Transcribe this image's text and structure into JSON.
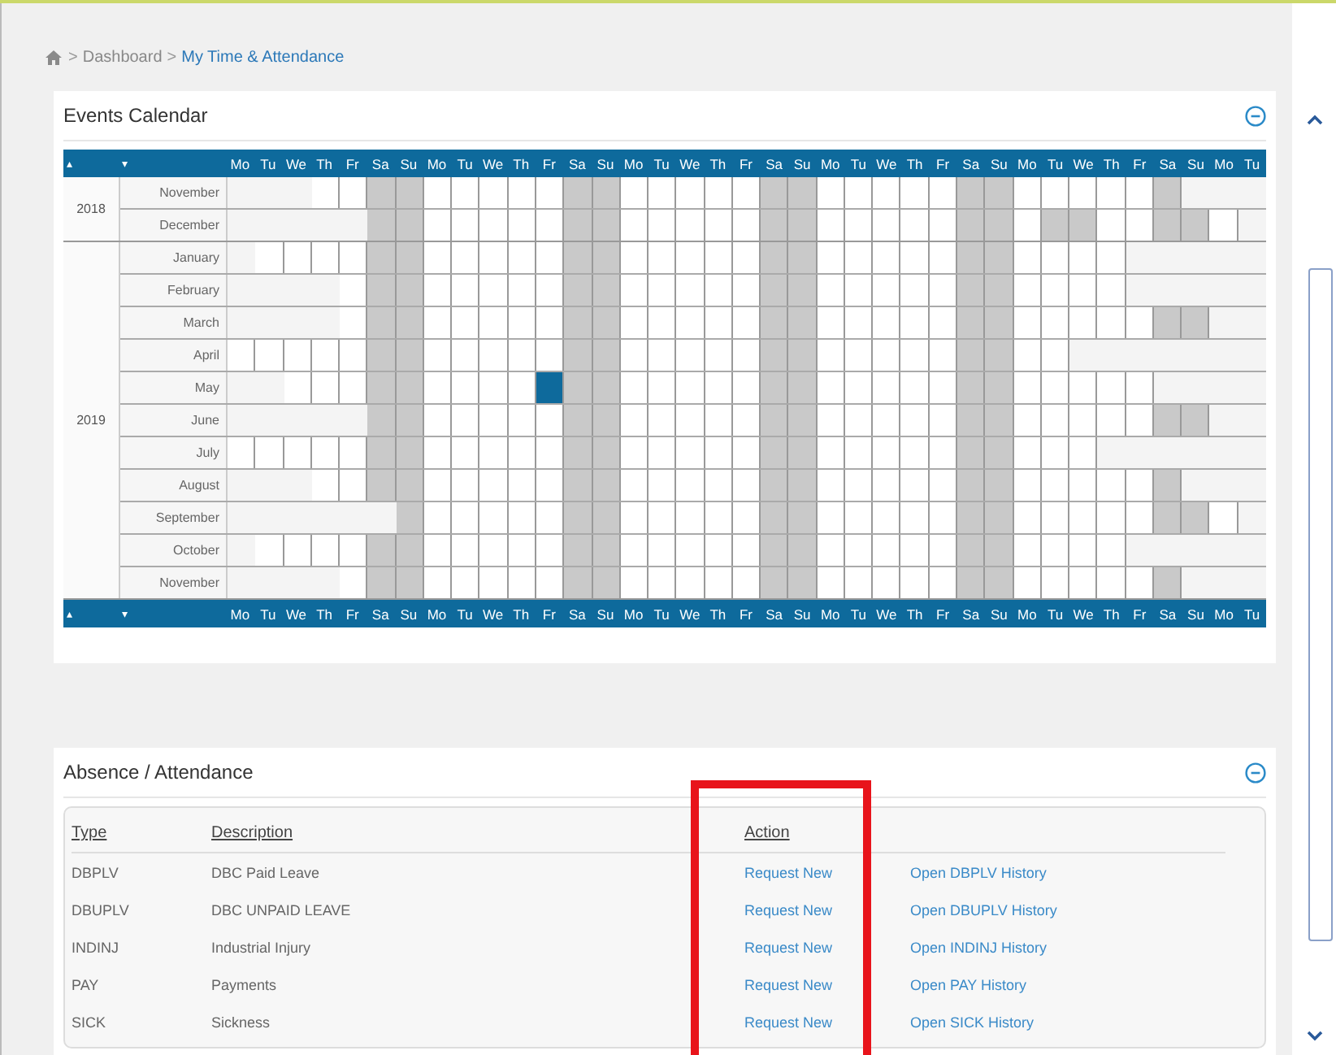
{
  "breadcrumb": {
    "separator": ">",
    "items": [
      {
        "label": "Dashboard",
        "current": false
      },
      {
        "label": "My Time & Attendance",
        "current": true
      }
    ]
  },
  "calendar": {
    "title": "Events Calendar",
    "header": {
      "prev": "▴",
      "next": "▾",
      "days": [
        "Mo",
        "Tu",
        "We",
        "Th",
        "Fr",
        "Sa",
        "Su",
        "Mo",
        "Tu",
        "We",
        "Th",
        "Fr",
        "Sa",
        "Su",
        "Mo",
        "Tu",
        "We",
        "Th",
        "Fr",
        "Sa",
        "Su",
        "Mo",
        "Tu",
        "We",
        "Th",
        "Fr",
        "Sa",
        "Su",
        "Mo",
        "Tu",
        "We",
        "Th",
        "Fr",
        "Sa",
        "Su",
        "Mo",
        "Tu"
      ]
    },
    "years": [
      {
        "year": "2018",
        "months": [
          {
            "name": "November",
            "cells": [
              {
                "kind": "out"
              },
              {
                "kind": "out"
              },
              {
                "kind": "out"
              },
              {
                "kind": "day"
              },
              {
                "kind": "day"
              },
              {
                "kind": "off"
              },
              {
                "kind": "off"
              },
              {
                "kind": "day"
              },
              {
                "kind": "day"
              },
              {
                "kind": "day"
              },
              {
                "kind": "day"
              },
              {
                "kind": "day"
              },
              {
                "kind": "off"
              },
              {
                "kind": "off"
              },
              {
                "kind": "day"
              },
              {
                "kind": "day"
              },
              {
                "kind": "day"
              },
              {
                "kind": "day"
              },
              {
                "kind": "day"
              },
              {
                "kind": "off"
              },
              {
                "kind": "off"
              },
              {
                "kind": "day"
              },
              {
                "kind": "day"
              },
              {
                "kind": "day"
              },
              {
                "kind": "day"
              },
              {
                "kind": "day"
              },
              {
                "kind": "off"
              },
              {
                "kind": "off"
              },
              {
                "kind": "day"
              },
              {
                "kind": "day"
              },
              {
                "kind": "day"
              },
              {
                "kind": "day"
              },
              {
                "kind": "day"
              },
              {
                "kind": "off"
              },
              {
                "kind": "out"
              },
              {
                "kind": "out"
              },
              {
                "kind": "out"
              }
            ]
          },
          {
            "name": "December",
            "cells": [
              {
                "kind": "out"
              },
              {
                "kind": "out"
              },
              {
                "kind": "out"
              },
              {
                "kind": "out"
              },
              {
                "kind": "out"
              },
              {
                "kind": "off"
              },
              {
                "kind": "off"
              },
              {
                "kind": "day"
              },
              {
                "kind": "day"
              },
              {
                "kind": "day"
              },
              {
                "kind": "day"
              },
              {
                "kind": "day"
              },
              {
                "kind": "off"
              },
              {
                "kind": "off"
              },
              {
                "kind": "day"
              },
              {
                "kind": "day"
              },
              {
                "kind": "day"
              },
              {
                "kind": "day"
              },
              {
                "kind": "day"
              },
              {
                "kind": "off"
              },
              {
                "kind": "off"
              },
              {
                "kind": "day"
              },
              {
                "kind": "day"
              },
              {
                "kind": "day"
              },
              {
                "kind": "day"
              },
              {
                "kind": "day"
              },
              {
                "kind": "off"
              },
              {
                "kind": "off"
              },
              {
                "kind": "day"
              },
              {
                "kind": "off"
              },
              {
                "kind": "off"
              },
              {
                "kind": "day"
              },
              {
                "kind": "day"
              },
              {
                "kind": "off"
              },
              {
                "kind": "off"
              },
              {
                "kind": "day"
              },
              {
                "kind": "out"
              }
            ]
          }
        ]
      },
      {
        "year": "2019",
        "months": [
          {
            "name": "January",
            "cells": [
              {
                "kind": "out"
              },
              {
                "kind": "day"
              },
              {
                "kind": "day"
              },
              {
                "kind": "day"
              },
              {
                "kind": "day"
              },
              {
                "kind": "off"
              },
              {
                "kind": "off"
              },
              {
                "kind": "day"
              },
              {
                "kind": "day"
              },
              {
                "kind": "day"
              },
              {
                "kind": "day"
              },
              {
                "kind": "day"
              },
              {
                "kind": "off"
              },
              {
                "kind": "off"
              },
              {
                "kind": "day"
              },
              {
                "kind": "day"
              },
              {
                "kind": "day"
              },
              {
                "kind": "day"
              },
              {
                "kind": "day"
              },
              {
                "kind": "off"
              },
              {
                "kind": "off"
              },
              {
                "kind": "day"
              },
              {
                "kind": "day"
              },
              {
                "kind": "day"
              },
              {
                "kind": "day"
              },
              {
                "kind": "day"
              },
              {
                "kind": "off"
              },
              {
                "kind": "off"
              },
              {
                "kind": "day"
              },
              {
                "kind": "day"
              },
              {
                "kind": "day"
              },
              {
                "kind": "day"
              },
              {
                "kind": "out"
              },
              {
                "kind": "out"
              },
              {
                "kind": "out"
              },
              {
                "kind": "out"
              },
              {
                "kind": "out"
              }
            ]
          },
          {
            "name": "February",
            "cells": [
              {
                "kind": "out"
              },
              {
                "kind": "out"
              },
              {
                "kind": "out"
              },
              {
                "kind": "out"
              },
              {
                "kind": "day"
              },
              {
                "kind": "off"
              },
              {
                "kind": "off"
              },
              {
                "kind": "day"
              },
              {
                "kind": "day"
              },
              {
                "kind": "day"
              },
              {
                "kind": "day"
              },
              {
                "kind": "day"
              },
              {
                "kind": "off"
              },
              {
                "kind": "off"
              },
              {
                "kind": "day"
              },
              {
                "kind": "day"
              },
              {
                "kind": "day"
              },
              {
                "kind": "day"
              },
              {
                "kind": "day"
              },
              {
                "kind": "off"
              },
              {
                "kind": "off"
              },
              {
                "kind": "day"
              },
              {
                "kind": "day"
              },
              {
                "kind": "day"
              },
              {
                "kind": "day"
              },
              {
                "kind": "day"
              },
              {
                "kind": "off"
              },
              {
                "kind": "off"
              },
              {
                "kind": "day"
              },
              {
                "kind": "day"
              },
              {
                "kind": "day"
              },
              {
                "kind": "day"
              },
              {
                "kind": "out"
              },
              {
                "kind": "out"
              },
              {
                "kind": "out"
              },
              {
                "kind": "out"
              },
              {
                "kind": "out"
              }
            ]
          },
          {
            "name": "March",
            "cells": [
              {
                "kind": "out"
              },
              {
                "kind": "out"
              },
              {
                "kind": "out"
              },
              {
                "kind": "out"
              },
              {
                "kind": "day"
              },
              {
                "kind": "off"
              },
              {
                "kind": "off"
              },
              {
                "kind": "day"
              },
              {
                "kind": "day"
              },
              {
                "kind": "day"
              },
              {
                "kind": "day"
              },
              {
                "kind": "day"
              },
              {
                "kind": "off"
              },
              {
                "kind": "off"
              },
              {
                "kind": "day"
              },
              {
                "kind": "day"
              },
              {
                "kind": "day"
              },
              {
                "kind": "day"
              },
              {
                "kind": "day"
              },
              {
                "kind": "off"
              },
              {
                "kind": "off"
              },
              {
                "kind": "day"
              },
              {
                "kind": "day"
              },
              {
                "kind": "day"
              },
              {
                "kind": "day"
              },
              {
                "kind": "day"
              },
              {
                "kind": "off"
              },
              {
                "kind": "off"
              },
              {
                "kind": "day"
              },
              {
                "kind": "day"
              },
              {
                "kind": "day"
              },
              {
                "kind": "day"
              },
              {
                "kind": "day"
              },
              {
                "kind": "off"
              },
              {
                "kind": "off"
              },
              {
                "kind": "out"
              },
              {
                "kind": "out"
              }
            ]
          },
          {
            "name": "April",
            "cells": [
              {
                "kind": "day"
              },
              {
                "kind": "day"
              },
              {
                "kind": "day"
              },
              {
                "kind": "day"
              },
              {
                "kind": "day"
              },
              {
                "kind": "off"
              },
              {
                "kind": "off"
              },
              {
                "kind": "day"
              },
              {
                "kind": "day"
              },
              {
                "kind": "day"
              },
              {
                "kind": "day"
              },
              {
                "kind": "day"
              },
              {
                "kind": "off"
              },
              {
                "kind": "off"
              },
              {
                "kind": "day"
              },
              {
                "kind": "day"
              },
              {
                "kind": "day"
              },
              {
                "kind": "day"
              },
              {
                "kind": "day"
              },
              {
                "kind": "off"
              },
              {
                "kind": "off"
              },
              {
                "kind": "day"
              },
              {
                "kind": "day"
              },
              {
                "kind": "day"
              },
              {
                "kind": "day"
              },
              {
                "kind": "day"
              },
              {
                "kind": "off"
              },
              {
                "kind": "off"
              },
              {
                "kind": "day"
              },
              {
                "kind": "day"
              },
              {
                "kind": "out"
              },
              {
                "kind": "out"
              },
              {
                "kind": "out"
              },
              {
                "kind": "out"
              },
              {
                "kind": "out"
              },
              {
                "kind": "out"
              },
              {
                "kind": "out"
              }
            ]
          },
          {
            "name": "May",
            "cells": [
              {
                "kind": "out"
              },
              {
                "kind": "out"
              },
              {
                "kind": "day"
              },
              {
                "kind": "day"
              },
              {
                "kind": "day"
              },
              {
                "kind": "off"
              },
              {
                "kind": "off"
              },
              {
                "kind": "day"
              },
              {
                "kind": "day"
              },
              {
                "kind": "day"
              },
              {
                "kind": "day"
              },
              {
                "kind": "event"
              },
              {
                "kind": "off"
              },
              {
                "kind": "off"
              },
              {
                "kind": "day"
              },
              {
                "kind": "day"
              },
              {
                "kind": "day"
              },
              {
                "kind": "day"
              },
              {
                "kind": "day"
              },
              {
                "kind": "off"
              },
              {
                "kind": "off"
              },
              {
                "kind": "day"
              },
              {
                "kind": "day"
              },
              {
                "kind": "day"
              },
              {
                "kind": "day"
              },
              {
                "kind": "day"
              },
              {
                "kind": "off"
              },
              {
                "kind": "off"
              },
              {
                "kind": "day"
              },
              {
                "kind": "day"
              },
              {
                "kind": "day"
              },
              {
                "kind": "day"
              },
              {
                "kind": "day"
              },
              {
                "kind": "out"
              },
              {
                "kind": "out"
              },
              {
                "kind": "out"
              },
              {
                "kind": "out"
              }
            ]
          },
          {
            "name": "June",
            "cells": [
              {
                "kind": "out"
              },
              {
                "kind": "out"
              },
              {
                "kind": "out"
              },
              {
                "kind": "out"
              },
              {
                "kind": "out"
              },
              {
                "kind": "off"
              },
              {
                "kind": "off"
              },
              {
                "kind": "day"
              },
              {
                "kind": "day"
              },
              {
                "kind": "day"
              },
              {
                "kind": "day"
              },
              {
                "kind": "day"
              },
              {
                "kind": "off"
              },
              {
                "kind": "off"
              },
              {
                "kind": "day"
              },
              {
                "kind": "day"
              },
              {
                "kind": "day"
              },
              {
                "kind": "day"
              },
              {
                "kind": "day"
              },
              {
                "kind": "off"
              },
              {
                "kind": "off"
              },
              {
                "kind": "day"
              },
              {
                "kind": "day"
              },
              {
                "kind": "day"
              },
              {
                "kind": "day"
              },
              {
                "kind": "day"
              },
              {
                "kind": "off"
              },
              {
                "kind": "off"
              },
              {
                "kind": "day"
              },
              {
                "kind": "day"
              },
              {
                "kind": "day"
              },
              {
                "kind": "day"
              },
              {
                "kind": "day"
              },
              {
                "kind": "off"
              },
              {
                "kind": "off"
              },
              {
                "kind": "out"
              },
              {
                "kind": "out"
              }
            ]
          },
          {
            "name": "July",
            "cells": [
              {
                "kind": "day"
              },
              {
                "kind": "day"
              },
              {
                "kind": "day"
              },
              {
                "kind": "day"
              },
              {
                "kind": "day"
              },
              {
                "kind": "off"
              },
              {
                "kind": "off"
              },
              {
                "kind": "day"
              },
              {
                "kind": "day"
              },
              {
                "kind": "day"
              },
              {
                "kind": "day"
              },
              {
                "kind": "day"
              },
              {
                "kind": "off"
              },
              {
                "kind": "off"
              },
              {
                "kind": "day"
              },
              {
                "kind": "day"
              },
              {
                "kind": "day"
              },
              {
                "kind": "day"
              },
              {
                "kind": "day"
              },
              {
                "kind": "off"
              },
              {
                "kind": "off"
              },
              {
                "kind": "day"
              },
              {
                "kind": "day"
              },
              {
                "kind": "day"
              },
              {
                "kind": "day"
              },
              {
                "kind": "day"
              },
              {
                "kind": "off"
              },
              {
                "kind": "off"
              },
              {
                "kind": "day"
              },
              {
                "kind": "day"
              },
              {
                "kind": "day"
              },
              {
                "kind": "out"
              },
              {
                "kind": "out"
              },
              {
                "kind": "out"
              },
              {
                "kind": "out"
              },
              {
                "kind": "out"
              },
              {
                "kind": "out"
              }
            ]
          },
          {
            "name": "August",
            "cells": [
              {
                "kind": "out"
              },
              {
                "kind": "out"
              },
              {
                "kind": "out"
              },
              {
                "kind": "day"
              },
              {
                "kind": "day"
              },
              {
                "kind": "off"
              },
              {
                "kind": "off"
              },
              {
                "kind": "day"
              },
              {
                "kind": "day"
              },
              {
                "kind": "day"
              },
              {
                "kind": "day"
              },
              {
                "kind": "day"
              },
              {
                "kind": "off"
              },
              {
                "kind": "off"
              },
              {
                "kind": "day"
              },
              {
                "kind": "day"
              },
              {
                "kind": "day"
              },
              {
                "kind": "day"
              },
              {
                "kind": "day"
              },
              {
                "kind": "off"
              },
              {
                "kind": "off"
              },
              {
                "kind": "day"
              },
              {
                "kind": "day"
              },
              {
                "kind": "day"
              },
              {
                "kind": "day"
              },
              {
                "kind": "day"
              },
              {
                "kind": "off"
              },
              {
                "kind": "off"
              },
              {
                "kind": "day"
              },
              {
                "kind": "day"
              },
              {
                "kind": "day"
              },
              {
                "kind": "day"
              },
              {
                "kind": "day"
              },
              {
                "kind": "off"
              },
              {
                "kind": "out"
              },
              {
                "kind": "out"
              },
              {
                "kind": "out"
              }
            ]
          },
          {
            "name": "September",
            "cells": [
              {
                "kind": "out"
              },
              {
                "kind": "out"
              },
              {
                "kind": "out"
              },
              {
                "kind": "out"
              },
              {
                "kind": "out"
              },
              {
                "kind": "out"
              },
              {
                "kind": "off"
              },
              {
                "kind": "day"
              },
              {
                "kind": "day"
              },
              {
                "kind": "day"
              },
              {
                "kind": "day"
              },
              {
                "kind": "day"
              },
              {
                "kind": "off"
              },
              {
                "kind": "off"
              },
              {
                "kind": "day"
              },
              {
                "kind": "day"
              },
              {
                "kind": "day"
              },
              {
                "kind": "day"
              },
              {
                "kind": "day"
              },
              {
                "kind": "off"
              },
              {
                "kind": "off"
              },
              {
                "kind": "day"
              },
              {
                "kind": "day"
              },
              {
                "kind": "day"
              },
              {
                "kind": "day"
              },
              {
                "kind": "day"
              },
              {
                "kind": "off"
              },
              {
                "kind": "off"
              },
              {
                "kind": "day"
              },
              {
                "kind": "day"
              },
              {
                "kind": "day"
              },
              {
                "kind": "day"
              },
              {
                "kind": "day"
              },
              {
                "kind": "off"
              },
              {
                "kind": "off"
              },
              {
                "kind": "day"
              },
              {
                "kind": "out"
              }
            ]
          },
          {
            "name": "October",
            "cells": [
              {
                "kind": "out"
              },
              {
                "kind": "day"
              },
              {
                "kind": "day"
              },
              {
                "kind": "day"
              },
              {
                "kind": "day"
              },
              {
                "kind": "off"
              },
              {
                "kind": "off"
              },
              {
                "kind": "day"
              },
              {
                "kind": "day"
              },
              {
                "kind": "day"
              },
              {
                "kind": "day"
              },
              {
                "kind": "day"
              },
              {
                "kind": "off"
              },
              {
                "kind": "off"
              },
              {
                "kind": "day"
              },
              {
                "kind": "day"
              },
              {
                "kind": "day"
              },
              {
                "kind": "day"
              },
              {
                "kind": "day"
              },
              {
                "kind": "off"
              },
              {
                "kind": "off"
              },
              {
                "kind": "day"
              },
              {
                "kind": "day"
              },
              {
                "kind": "day"
              },
              {
                "kind": "day"
              },
              {
                "kind": "day"
              },
              {
                "kind": "off"
              },
              {
                "kind": "off"
              },
              {
                "kind": "day"
              },
              {
                "kind": "day"
              },
              {
                "kind": "day"
              },
              {
                "kind": "day"
              },
              {
                "kind": "out"
              },
              {
                "kind": "out"
              },
              {
                "kind": "out"
              },
              {
                "kind": "out"
              },
              {
                "kind": "out"
              }
            ]
          },
          {
            "name": "November",
            "cells": [
              {
                "kind": "out"
              },
              {
                "kind": "out"
              },
              {
                "kind": "out"
              },
              {
                "kind": "out"
              },
              {
                "kind": "day"
              },
              {
                "kind": "off"
              },
              {
                "kind": "off"
              },
              {
                "kind": "day"
              },
              {
                "kind": "day"
              },
              {
                "kind": "day"
              },
              {
                "kind": "day"
              },
              {
                "kind": "day"
              },
              {
                "kind": "off"
              },
              {
                "kind": "off"
              },
              {
                "kind": "day"
              },
              {
                "kind": "day"
              },
              {
                "kind": "day"
              },
              {
                "kind": "day"
              },
              {
                "kind": "day"
              },
              {
                "kind": "off"
              },
              {
                "kind": "off"
              },
              {
                "kind": "day"
              },
              {
                "kind": "day"
              },
              {
                "kind": "day"
              },
              {
                "kind": "day"
              },
              {
                "kind": "day"
              },
              {
                "kind": "off"
              },
              {
                "kind": "off"
              },
              {
                "kind": "day"
              },
              {
                "kind": "day"
              },
              {
                "kind": "day"
              },
              {
                "kind": "day"
              },
              {
                "kind": "day"
              },
              {
                "kind": "off"
              },
              {
                "kind": "out"
              },
              {
                "kind": "out"
              },
              {
                "kind": "out"
              }
            ]
          }
        ]
      }
    ],
    "footer": {
      "prev": "▴",
      "next": "▾",
      "days": [
        "Mo",
        "Tu",
        "We",
        "Th",
        "Fr",
        "Sa",
        "Su",
        "Mo",
        "Tu",
        "We",
        "Th",
        "Fr",
        "Sa",
        "Su",
        "Mo",
        "Tu",
        "We",
        "Th",
        "Fr",
        "Sa",
        "Su",
        "Mo",
        "Tu",
        "We",
        "Th",
        "Fr",
        "Sa",
        "Su",
        "Mo",
        "Tu",
        "We",
        "Th",
        "Fr",
        "Sa",
        "Su",
        "Mo",
        "Tu"
      ]
    }
  },
  "absence": {
    "title": "Absence / Attendance",
    "columns": [
      "Type",
      "Description",
      "Action"
    ],
    "rows": [
      {
        "type": "DBPLV",
        "description": "DBC Paid Leave",
        "action": "Request New",
        "history": "Open DBPLV History"
      },
      {
        "type": "DBUPLV",
        "description": "DBC UNPAID LEAVE",
        "action": "Request New",
        "history": "Open DBUPLV History"
      },
      {
        "type": "INDINJ",
        "description": "Industrial Injury",
        "action": "Request New",
        "history": "Open INDINJ History"
      },
      {
        "type": "PAY",
        "description": "Payments",
        "action": "Request New",
        "history": "Open PAY History"
      },
      {
        "type": "SICK",
        "description": "Sickness",
        "action": "Request New",
        "history": "Open SICK History"
      }
    ]
  }
}
